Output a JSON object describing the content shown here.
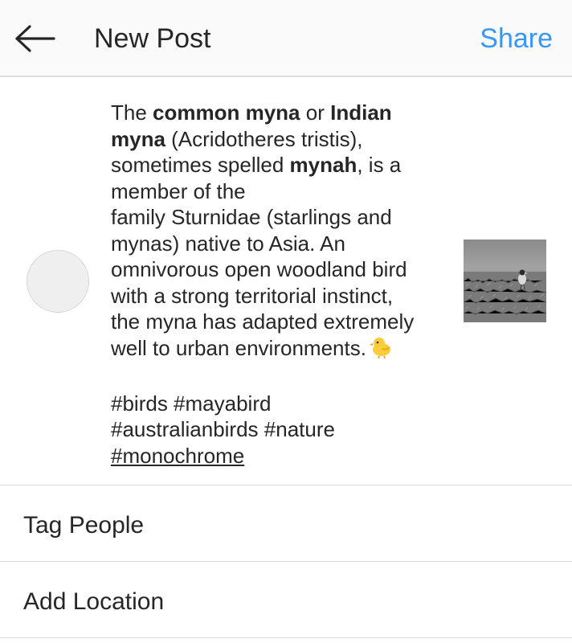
{
  "header": {
    "back_icon": "arrow-left-icon",
    "title": "New Post",
    "share_label": "Share",
    "share_color": "#3897f0"
  },
  "compose": {
    "caption": {
      "l1_a": "The ",
      "l1_b": "common myna",
      "l1_c": " or ",
      "l1_d": "Indian",
      "l2_a": "myna",
      "l2_b": " (Acridotheres tristis),",
      "l3_a": "sometimes spelled ",
      "l3_b": "mynah",
      "l3_c": ", is a",
      "l4": "member of the",
      "l5": "family Sturnidae (starlings and",
      "l6": "mynas) native to Asia. An",
      "l7": "omnivorous open woodland bird",
      "l8": "with a strong territorial instinct,",
      "l9": "the myna has adapted extremely",
      "l10": "well to urban environments.",
      "emoji_icon": "baby-chick-icon",
      "tags_l1": "#birds #mayabird",
      "tags_l2": "#australianbirds #nature",
      "tags_l3": "#monochrome"
    },
    "thumbnail": "myna-bird-photo-monochrome"
  },
  "options": {
    "tag_people": "Tag People",
    "add_location": "Add Location"
  }
}
